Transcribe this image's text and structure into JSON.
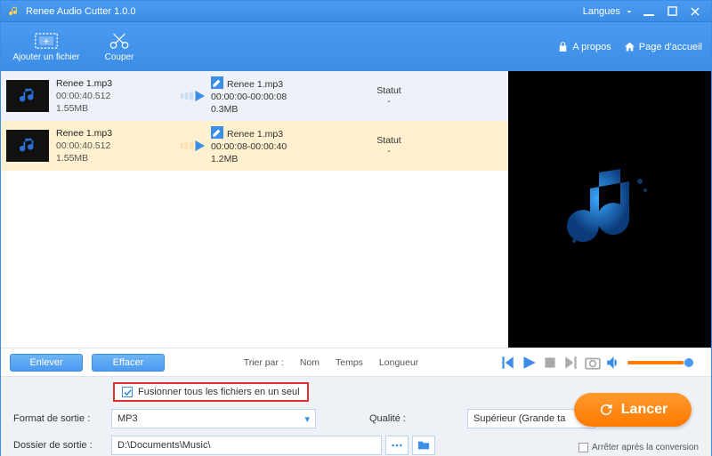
{
  "title": "Renee Audio Cutter 1.0.0",
  "lang_label": "Langues",
  "toolbar": {
    "add_label": "Ajouter un fichier",
    "cut_label": "Couper",
    "about_label": "A propos",
    "home_label": "Page d'accueil"
  },
  "rows": [
    {
      "name": "Renee 1.mp3",
      "dur": "00:00:40.512",
      "size": "1.55MB",
      "out_name": "Renee 1.mp3",
      "out_range": "00:00:00-00:00:08",
      "out_size": "0.3MB",
      "status_label": "Statut",
      "status_val": "-"
    },
    {
      "name": "Renee 1.mp3",
      "dur": "00:00:40.512",
      "size": "1.55MB",
      "out_name": "Renee 1.mp3",
      "out_range": "00:00:08-00:00:40",
      "out_size": "1.2MB",
      "status_label": "Statut",
      "status_val": "-"
    }
  ],
  "buttons": {
    "remove": "Enlever",
    "clear": "Effacer"
  },
  "sort": {
    "label": "Trier par :",
    "name": "Nom",
    "time": "Temps",
    "length": "Longueur"
  },
  "merge_label": "Fusionner tous les fichiers en un seul",
  "format": {
    "label": "Format de sortie :",
    "value": "MP3"
  },
  "quality": {
    "label": "Qualité :",
    "value": "Supérieur (Grande ta"
  },
  "folder": {
    "label": "Dossier de sortie :",
    "value": "D:\\Documents\\Music\\"
  },
  "launch_label": "Lancer",
  "stop_label": "Arrêter après la conversion",
  "colors": {
    "brand": "#3b8de6",
    "accent": "#ff7a00",
    "highlight_red": "#e03030"
  }
}
